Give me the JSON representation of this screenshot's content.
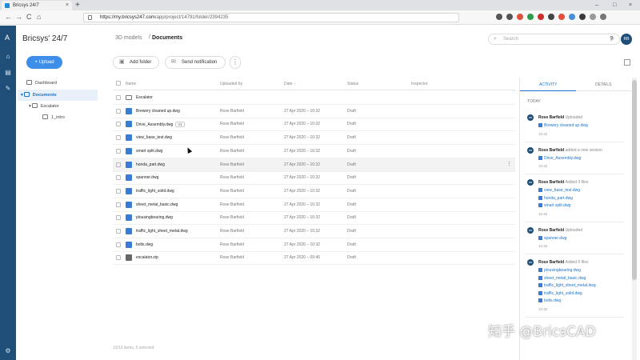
{
  "browser": {
    "tab_title": "Bricsys 24/7",
    "tab_close": "×",
    "new_tab": "+",
    "url_host": "https://my.bricsys247.com",
    "url_path": "/app/project/14791/folder/2394235",
    "back": "←",
    "forward": "→",
    "reload": "C",
    "home": "⌂",
    "minimize": "–",
    "maximize": "□",
    "close": "×",
    "ext_icon_colors": [
      "#555555",
      "#555555",
      "#e0503c",
      "#2a9d4c",
      "#cc2d2d",
      "#444444",
      "#e0503c",
      "#4a90d9",
      "#3a3a3a",
      "#999999",
      "#777777"
    ]
  },
  "app": {
    "brand": "Bricsys' 24/7",
    "logo": "A",
    "search_placeholder": "Search",
    "search_icon": "⌕",
    "search_clear": "⊗",
    "user_initials": "RB",
    "accent": "#3d8ee8",
    "rail_color": "#1f4e79"
  },
  "breadcrumb": {
    "parent": "3D models",
    "separator": "/",
    "current": "Documents"
  },
  "rail": {
    "home_icon": "⌂",
    "inbox_icon": "▤",
    "tools_icon": "✎",
    "settings_icon": "⚙"
  },
  "sidebar": {
    "upload_label": "+ Upload",
    "items": [
      {
        "label": "Dashboard"
      },
      {
        "label": "Documents"
      },
      {
        "label": "Escalator"
      },
      {
        "label": "1_intro"
      }
    ],
    "expand_icon": "▾"
  },
  "toolbar": {
    "add_folder": "Add folder",
    "add_folder_icon": "▣",
    "send_notification": "Send notification",
    "send_icon": "✉",
    "more": "⋮"
  },
  "table": {
    "columns": [
      "Name",
      "Uploaded by",
      "Date ↓",
      "Status",
      "Inspector"
    ],
    "rows": [
      {
        "type": "folder",
        "name": "Escalator",
        "by": "",
        "date": "",
        "status": "",
        "version": ""
      },
      {
        "type": "dwg",
        "name": "Brewery cleaned up.dwg",
        "by": "Rose Barfield",
        "date": "27 Apr 2020 – 10:32",
        "status": "Draft",
        "version": ""
      },
      {
        "type": "dwg",
        "name": "Drive_Assembly.dwg",
        "by": "Rose Barfield",
        "date": "27 Apr 2020 – 10:32",
        "status": "Draft",
        "version": "V1"
      },
      {
        "type": "dwg",
        "name": "view_base_test.dwg",
        "by": "Rose Barfield",
        "date": "27 Apr 2020 – 10:32",
        "status": "Draft",
        "version": ""
      },
      {
        "type": "dwg",
        "name": "smart split.dwg",
        "by": "Rose Barfield",
        "date": "27 Apr 2020 – 10:32",
        "status": "Draft",
        "version": ""
      },
      {
        "type": "dwg",
        "name": "honda_part.dwg",
        "by": "Rose Barfield",
        "date": "27 Apr 2020 – 10:32",
        "status": "Draft",
        "version": ""
      },
      {
        "type": "dwg",
        "name": "spanner.dwg",
        "by": "Rose Barfield",
        "date": "27 Apr 2020 – 10:32",
        "status": "Draft",
        "version": ""
      },
      {
        "type": "dwg",
        "name": "traffic_light_solid.dwg",
        "by": "Rose Barfield",
        "date": "27 Apr 2020 – 10:32",
        "status": "Draft",
        "version": ""
      },
      {
        "type": "dwg",
        "name": "sheet_metal_basic.dwg",
        "by": "Rose Barfield",
        "date": "27 Apr 2020 – 10:32",
        "status": "Draft",
        "version": ""
      },
      {
        "type": "dwg",
        "name": "plousingbearing.dwg",
        "by": "Rose Barfield",
        "date": "27 Apr 2020 – 10:32",
        "status": "Draft",
        "version": ""
      },
      {
        "type": "dwg",
        "name": "traffic_light_sheet_metal.dwg",
        "by": "Rose Barfield",
        "date": "27 Apr 2020 – 10:32",
        "status": "Draft",
        "version": ""
      },
      {
        "type": "dwg",
        "name": "bolts.dwg",
        "by": "Rose Barfield",
        "date": "27 Apr 2020 – 10:32",
        "status": "Draft",
        "version": ""
      },
      {
        "type": "zip",
        "name": "escalator.zip",
        "by": "Rose Barfield",
        "date": "27 Apr 2020 – 09:46",
        "status": "Draft",
        "version": ""
      }
    ],
    "row_more": "⋮",
    "footer": "13/13 items, 0 selected"
  },
  "activity": {
    "tab_activity": "ACTIVITY",
    "tab_details": "DETAILS",
    "today": "TODAY",
    "cards": [
      {
        "user": "Rose Barfield",
        "action": "Uploaded",
        "files": [
          "Brewery cleaned up.dwg"
        ],
        "time": "10:32"
      },
      {
        "user": "Rose Barfield",
        "action": "added a new version",
        "files": [
          "Drive_Assembly.dwg"
        ],
        "time": "10:32"
      },
      {
        "user": "Rose Barfield",
        "action": "Added 3 files",
        "files": [
          "view_base_test.dwg",
          "honda_part.dwg",
          "smart split.dwg"
        ],
        "time": "10:32"
      },
      {
        "user": "Rose Barfield",
        "action": "Uploaded",
        "files": [
          "spanner.dwg"
        ],
        "time": "10:32"
      },
      {
        "user": "Rose Barfield",
        "action": "Added 5 files",
        "files": [
          "plousingbearing.dwg",
          "sheet_metal_basic.dwg",
          "traffic_light_sheet_metal.dwg",
          "traffic_light_solid.dwg",
          "bolts.dwg"
        ],
        "time": "10:32"
      }
    ]
  },
  "watermark": "知乎 @BricsCAD"
}
